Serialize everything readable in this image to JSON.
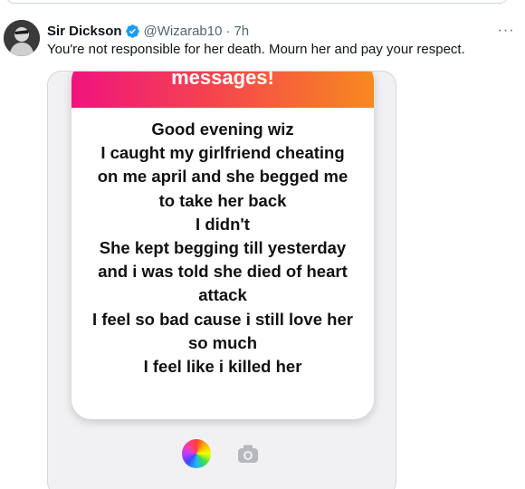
{
  "tweet": {
    "author_name": "Sir Dickson",
    "handle": "@Wizarab10",
    "separator": "·",
    "time": "7h",
    "text": "You're not responsible for her death. Mourn her and pay your respect.",
    "more_label": "···"
  },
  "media": {
    "header_text": "messages!",
    "body_lines": [
      "Good evening wiz",
      "I caught my girlfriend cheating",
      "on me april and she begged me",
      "to take her back",
      "I didn't",
      "She kept begging till yesterday",
      "and i was told she died of heart",
      "attack",
      "I feel so bad cause i still love her",
      "so much",
      "I feel like i killed her"
    ],
    "header_gradient": [
      "#f0147d",
      "#f5484b",
      "#f7891f"
    ]
  },
  "icons": {
    "verified": "verified-badge-icon",
    "more": "more-options-icon",
    "color": "color-wheel-icon",
    "camera": "camera-icon"
  },
  "colors": {
    "verified_blue": "#1d9bf0",
    "secondary_text": "#536471",
    "primary_text": "#0f1419"
  }
}
